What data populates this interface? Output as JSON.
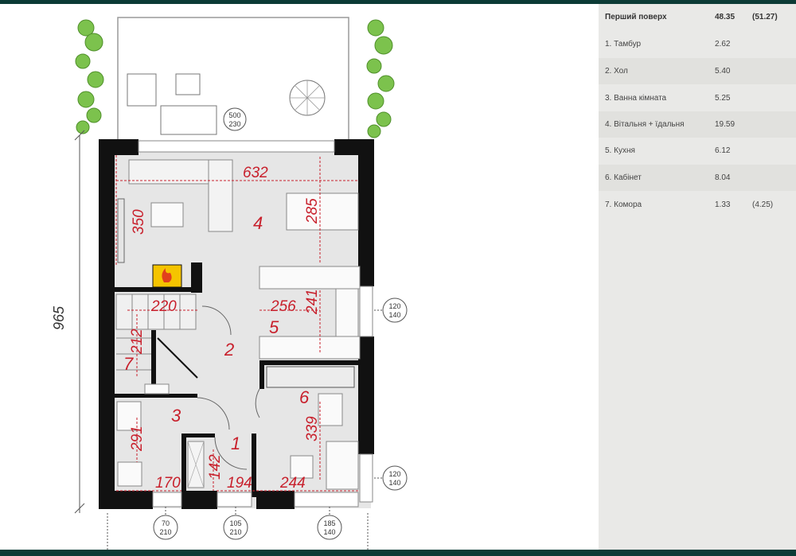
{
  "table": {
    "title": "Перший поверх",
    "total": "48.35",
    "total_alt": "(51.27)",
    "rows": [
      {
        "name": "1. Тамбур",
        "area": "2.62"
      },
      {
        "name": "2. Хол",
        "area": "5.40"
      },
      {
        "name": "3. Ванна кімната",
        "area": "5.25"
      },
      {
        "name": "4. Вітальня + їдальня",
        "area": "19.59"
      },
      {
        "name": "5. Кухня",
        "area": "6.12"
      },
      {
        "name": "6. Кабінет",
        "area": "8.04"
      },
      {
        "name": "7. Комора",
        "area": "1.33",
        "area_alt": "(4.25)"
      }
    ]
  },
  "plan": {
    "overall_dim": "965",
    "dims": [
      "632",
      "350",
      "285",
      "220",
      "256",
      "241",
      "212",
      "291",
      "339",
      "170",
      "142",
      "194",
      "244"
    ],
    "room_numbers": {
      "1": "1",
      "2": "2",
      "3": "3",
      "4": "4",
      "5": "5",
      "6": "6",
      "7": "7"
    },
    "window_tags": [
      {
        "top": "120",
        "bottom": "140"
      },
      {
        "top": "120",
        "bottom": "140"
      },
      {
        "top": "70",
        "bottom": "210"
      },
      {
        "top": "105",
        "bottom": "210"
      },
      {
        "top": "185",
        "bottom": "140"
      }
    ],
    "terrace_tag": {
      "top": "500",
      "bottom": "230"
    }
  },
  "colors": {
    "frame": "#0c3b36",
    "dimension_red": "#c8202c",
    "table_bg": "#e9e9e7",
    "fireplace": "#f5c400",
    "hedge": "#7cc24d"
  }
}
